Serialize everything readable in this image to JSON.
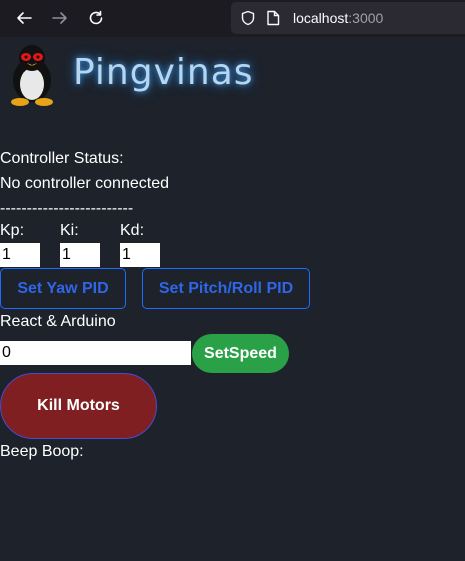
{
  "browser": {
    "url_host": "localhost",
    "url_port": ":3000",
    "icons": [
      "back-arrow-icon",
      "forward-arrow-icon",
      "reload-icon",
      "shield-icon",
      "page-icon"
    ]
  },
  "header": {
    "title": "Pingvinas",
    "logo": "tux-penguin-logo"
  },
  "status": {
    "label": "Controller Status:",
    "value": "No controller connected",
    "divider": "-------------------------"
  },
  "pid": {
    "kp_label": "Kp:",
    "ki_label": "Ki:",
    "kd_label": "Kd:",
    "kp_value": "1",
    "ki_value": "1",
    "kd_value": "1",
    "yaw_button": "Set Yaw PID",
    "pitch_roll_button": "Set Pitch/Roll PID"
  },
  "arduino": {
    "label": "React & Arduino",
    "speed_value": "0",
    "speed_button": "SetSpeed"
  },
  "kill": {
    "button": "Kill Motors"
  },
  "beep": {
    "label": "Beep Boop:"
  },
  "colors": {
    "background": "#1d222b",
    "title_glow": "#3a8dd8",
    "pid_button": "#2f66e8",
    "speed_button": "#2aa147",
    "kill_button": "#7f1f22"
  }
}
